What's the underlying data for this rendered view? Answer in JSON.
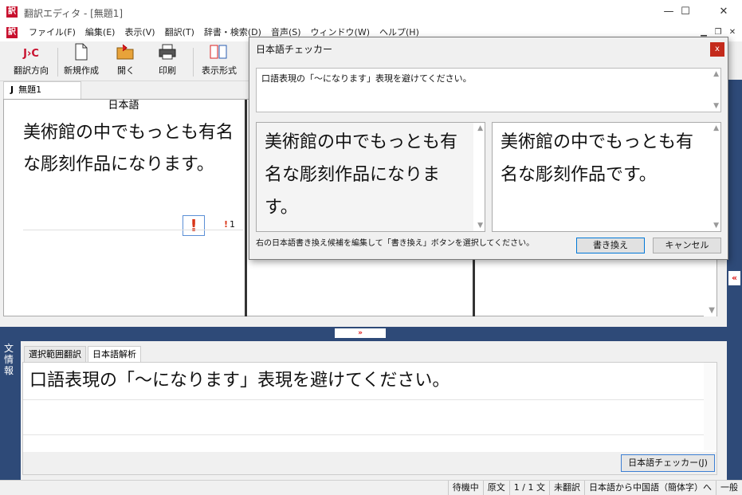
{
  "window": {
    "app_icon": "訳",
    "title": "翻訳エディタ - [無題1]",
    "minimize": "—",
    "maximize": "☐",
    "close": "✕"
  },
  "menu": {
    "app_icon": "訳",
    "items": [
      "ファイル(F)",
      "編集(E)",
      "表示(V)",
      "翻訳(T)",
      "辞書・検索(D)",
      "音声(S)",
      "ウィンドウ(W)",
      "ヘルプ(H)"
    ],
    "mdi_min": "▁",
    "mdi_restore": "❐",
    "mdi_close": "✕"
  },
  "toolbar": {
    "direction": "翻訳方向",
    "direction_icon": "J›C",
    "new": "新規作成",
    "open": "開く",
    "print": "印刷",
    "display": "表示形式",
    "more": ""
  },
  "document_tab": {
    "prefix": "J",
    "label": "無題1"
  },
  "editor": {
    "source_header": "日本語",
    "source_text": "美術館の中でもっとも有名な彫刻作品になります。",
    "warning_mark": "!",
    "warning_count": "1",
    "warning_count_mark": "!"
  },
  "info_panel": {
    "side_label": "文情報",
    "tabs": [
      "選択範囲翻訳",
      "日本語解析"
    ],
    "message": "口語表現の「〜になります」表現を避けてください。",
    "checker_button": "日本語チェッカー(J)"
  },
  "splitter": {
    "handle": "»"
  },
  "right_panel": {
    "collapse": "«"
  },
  "statusbar": {
    "items": [
      "待機中",
      "原文",
      "1 / 1 文",
      "未翻訳",
      "日本語から中国語（簡体字）へ",
      "一般"
    ]
  },
  "dialog": {
    "title": "日本語チェッカー",
    "close": "x",
    "message": "口語表現の「〜になります」表現を避けてください。",
    "original_text": "美術館の中でもっとも有名な彫刻作品になります。",
    "suggested_text": "美術館の中でもっとも有名な彫刻作品です。",
    "instruction": "右の日本語書き換え候補を編集して「書き換え」ボタンを選択してください。",
    "rewrite_button": "書き換え",
    "cancel_button": "キャンセル"
  }
}
